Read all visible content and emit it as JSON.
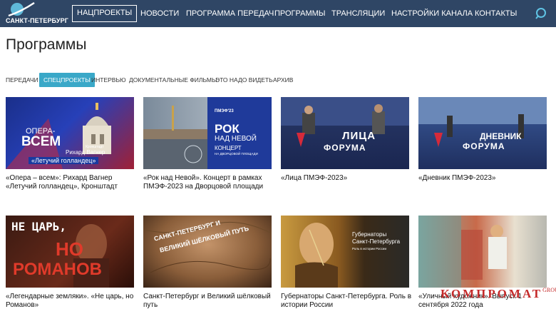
{
  "header": {
    "logo_text": "САНКТ-ПЕТЕРБУРГ",
    "nav": [
      {
        "label": "НАЦПРОЕКТЫ",
        "active": true
      },
      {
        "label": "НОВОСТИ"
      },
      {
        "label": "ПРОГРАММА ПЕРЕДАЧ"
      },
      {
        "label": "ПРОГРАММЫ"
      },
      {
        "label": "ТРАНСЛЯЦИИ"
      },
      {
        "label": "НАСТРОЙКИ КАНАЛА"
      },
      {
        "label": "КОНТАКТЫ"
      }
    ],
    "search_icon": "search-icon",
    "bg_color": "#2f4665"
  },
  "page_title": "Программы",
  "tabs": [
    {
      "label": "ПЕРЕДАЧИ"
    },
    {
      "label": "СПЕЦПРОЕКТЫ",
      "active": true
    },
    {
      "label": "ИНТЕРВЬЮ"
    },
    {
      "label": "ДОКУМЕНТАЛЬНЫЕ ФИЛЬМЫ"
    },
    {
      "label": "ЭТО НАДО ВИДЕТЬ"
    },
    {
      "label": "АРХИВ"
    }
  ],
  "accent_color": "#3aa8c8",
  "cards": [
    {
      "caption": "«Опера – всем»: Рихард Вагнер «Летучий голландец», Кронштадт",
      "thumb": {
        "line1": "ОПЕРА-",
        "line2": "ВСЕМ",
        "sub1": "Рихард Вагнер",
        "sub2": "«Летучий голландец»",
        "small": "Кронштадт"
      }
    },
    {
      "caption": "«Рок над Невой». Концерт в рамках ПМЭФ-2023 на Дворцовой площади",
      "thumb": {
        "badge": "ПМЭФ'23",
        "line1": "РОК",
        "line2": "НАД НЕВОЙ",
        "sub1": "КОНЦЕРТ",
        "sub2": "НА ДВОРЦОВОЙ ПЛОЩАДИ"
      }
    },
    {
      "caption": "«Лица ПМЭФ-2023»",
      "thumb": {
        "line1": "ЛИЦА",
        "line2": "ФОРУМА"
      }
    },
    {
      "caption": "«Дневник ПМЭФ-2023»",
      "thumb": {
        "line1": "ДНЕВНИК",
        "line2": "ФОРУМА"
      }
    },
    {
      "caption": "«Легендарные земляки». «Не царь, но Романов»",
      "thumb": {
        "line1": "НЕ ЦАРЬ,",
        "line2": "НО",
        "line3": "РОМАНОВ"
      }
    },
    {
      "caption": "Санкт-Петербург и Великий шёлковый путь",
      "thumb": {
        "line1": "САНКТ-ПЕТЕРБУРГ И",
        "line2": "ВЕЛИКИЙ ШЁЛКОВЫЙ ПУТЬ"
      }
    },
    {
      "caption": "Губернаторы Санкт-Петербурга. Роль в истории России",
      "thumb": {
        "line1": "Губернаторы",
        "line2": "Санкт-Петербурга",
        "sub1": "Роль в истории России"
      }
    },
    {
      "caption": "«Уличный художник». Выпуск 1 сентября 2022 года",
      "thumb": {}
    }
  ],
  "watermark": {
    "text": "КОМПРОМАТ",
    "suffix": "GROUP"
  }
}
